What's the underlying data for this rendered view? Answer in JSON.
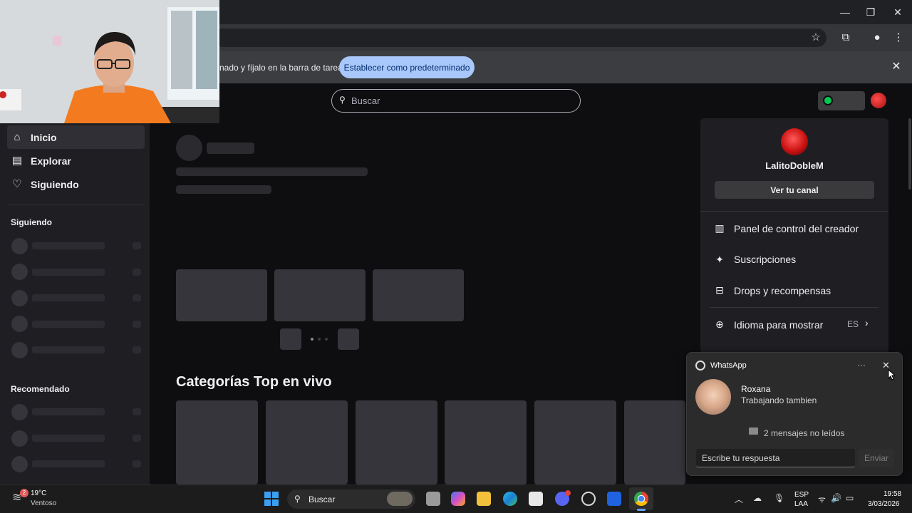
{
  "browser": {
    "window_controls": {
      "minimize": "—",
      "maximize": "❐",
      "close": "✕"
    },
    "toolbar_icons": [
      "star-icon",
      "extensions-icon",
      "profile-icon",
      "menu-icon"
    ],
    "infobar": {
      "text": "nado y fíjalo en la barra de tareas",
      "button": "Establecer como predeterminado",
      "close": "✕"
    }
  },
  "topbar": {
    "search": {
      "placeholder": "Buscar",
      "icon": "search-icon"
    }
  },
  "sidebar": {
    "nav": [
      {
        "label": "Inicio",
        "icon": "home-icon",
        "active": true
      },
      {
        "label": "Explorar",
        "icon": "browse-icon",
        "active": false
      },
      {
        "label": "Siguiendo",
        "icon": "heart-icon",
        "active": false
      }
    ],
    "following_title": "Siguiendo",
    "recommended_title": "Recomendado"
  },
  "main": {
    "categories_heading": "Categorías Top en vivo"
  },
  "profile_menu": {
    "username": "LalitoDobleM",
    "view_channel": "Ver tu canal",
    "items": [
      {
        "label": "Panel de control del creador",
        "icon": "dashboard-icon"
      },
      {
        "label": "Suscripciones",
        "icon": "sparkle-icon"
      },
      {
        "label": "Drops y recompensas",
        "icon": "drops-icon"
      }
    ],
    "language": {
      "label": "Idioma para mostrar",
      "value": "ES",
      "icon": "globe-icon"
    }
  },
  "whatsapp_toast": {
    "app_name": "WhatsApp",
    "more": "···",
    "close": "✕",
    "sender": "Roxana",
    "message": "Trabajando tambien",
    "unread": "2 mensajes no leídos",
    "reply_placeholder": "Escribe tu respuesta",
    "send": "Enviar"
  },
  "taskbar": {
    "weather": {
      "temp": "19°C",
      "condition": "Ventoso",
      "badge": "2"
    },
    "search_label": "Buscar",
    "language": {
      "line1": "ESP",
      "line2": "LAA"
    },
    "clock": {
      "time": "19:58",
      "date": "3/03/2026"
    }
  },
  "colors": {
    "twitch_bg": "#0e0e10",
    "panel_bg": "#1f1f23",
    "chrome_default_button": "#a8c7fa",
    "windows_accent": "#3aa0f3"
  }
}
